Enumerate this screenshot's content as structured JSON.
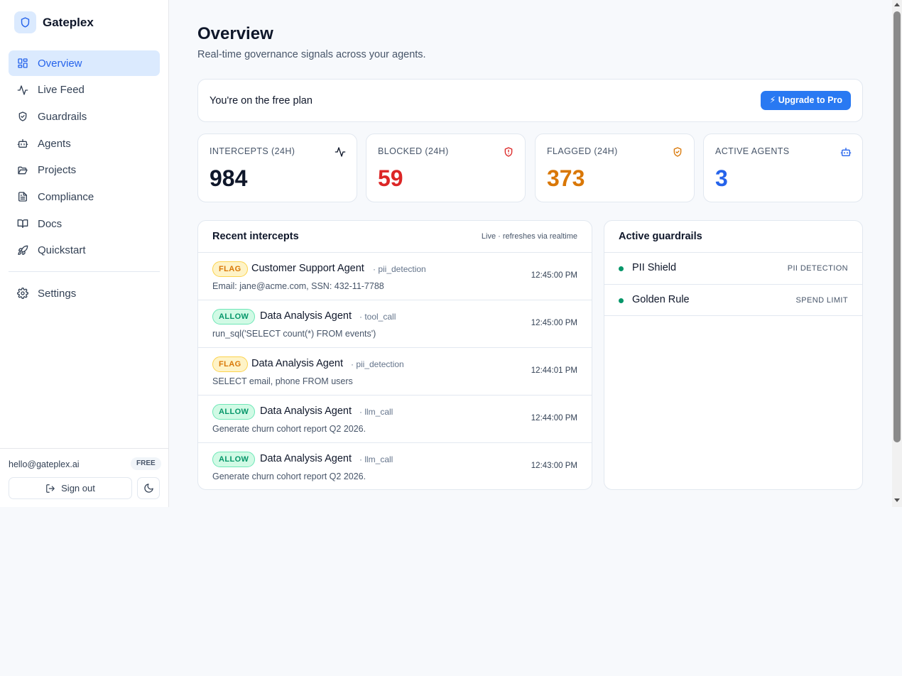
{
  "app": {
    "name": "Gateplex"
  },
  "sidebar": {
    "items": [
      {
        "label": "Overview",
        "icon": "dashboard-icon",
        "active": true
      },
      {
        "label": "Live Feed",
        "icon": "activity-icon"
      },
      {
        "label": "Guardrails",
        "icon": "shield-check-icon"
      },
      {
        "label": "Agents",
        "icon": "bot-icon"
      },
      {
        "label": "Projects",
        "icon": "folder-open-icon"
      },
      {
        "label": "Compliance",
        "icon": "document-icon"
      },
      {
        "label": "Docs",
        "icon": "book-icon"
      },
      {
        "label": "Quickstart",
        "icon": "rocket-icon"
      }
    ],
    "settings": {
      "label": "Settings",
      "icon": "gear-icon"
    },
    "footer": {
      "email": "hello@gateplex.ai",
      "plan_badge": "FREE",
      "signout_label": "Sign out",
      "theme_icon": "moon-icon"
    }
  },
  "header": {
    "title": "Overview",
    "subtitle": "Real-time governance signals across your agents."
  },
  "plan_banner": {
    "text": "You're on the free plan",
    "button_label": "⚡ Upgrade to Pro",
    "button_color": "#2979f2"
  },
  "stats": [
    {
      "label": "INTERCEPTS (24H)",
      "value": "984",
      "color": "#0f172a",
      "icon": "activity-icon"
    },
    {
      "label": "BLOCKED (24H)",
      "value": "59",
      "color": "#dc2626",
      "icon": "shield-alert-icon"
    },
    {
      "label": "FLAGGED (24H)",
      "value": "373",
      "color": "#d97706",
      "icon": "shield-check-icon"
    },
    {
      "label": "ACTIVE AGENTS",
      "value": "3",
      "color": "#2563eb",
      "icon": "bot-icon"
    }
  ],
  "recent": {
    "title": "Recent intercepts",
    "note": "Live · refreshes via realtime",
    "rows": [
      {
        "status": "FLAG",
        "agent": "Customer Support Agent",
        "type": "· pii_detection",
        "detail": "Email: jane@acme.com, SSN: 432-11-7788",
        "time": "12:45:00 PM"
      },
      {
        "status": "ALLOW",
        "agent": "Data Analysis Agent",
        "type": "· tool_call",
        "detail": "run_sql('SELECT count(*) FROM events')",
        "time": "12:45:00 PM"
      },
      {
        "status": "FLAG",
        "agent": "Data Analysis Agent",
        "type": "· pii_detection",
        "detail": "SELECT email, phone FROM users",
        "time": "12:44:01 PM"
      },
      {
        "status": "ALLOW",
        "agent": "Data Analysis Agent",
        "type": "· llm_call",
        "detail": "Generate churn cohort report Q2 2026.",
        "time": "12:44:00 PM"
      },
      {
        "status": "ALLOW",
        "agent": "Data Analysis Agent",
        "type": "· llm_call",
        "detail": "Generate churn cohort report Q2 2026.",
        "time": "12:43:00 PM"
      }
    ]
  },
  "guardrails": {
    "title": "Active guardrails",
    "items": [
      {
        "name": "PII Shield",
        "kind": "PII DETECTION",
        "status_color": "#059669"
      },
      {
        "name": "Golden Rule",
        "kind": "SPEND LIMIT",
        "status_color": "#059669"
      }
    ]
  }
}
